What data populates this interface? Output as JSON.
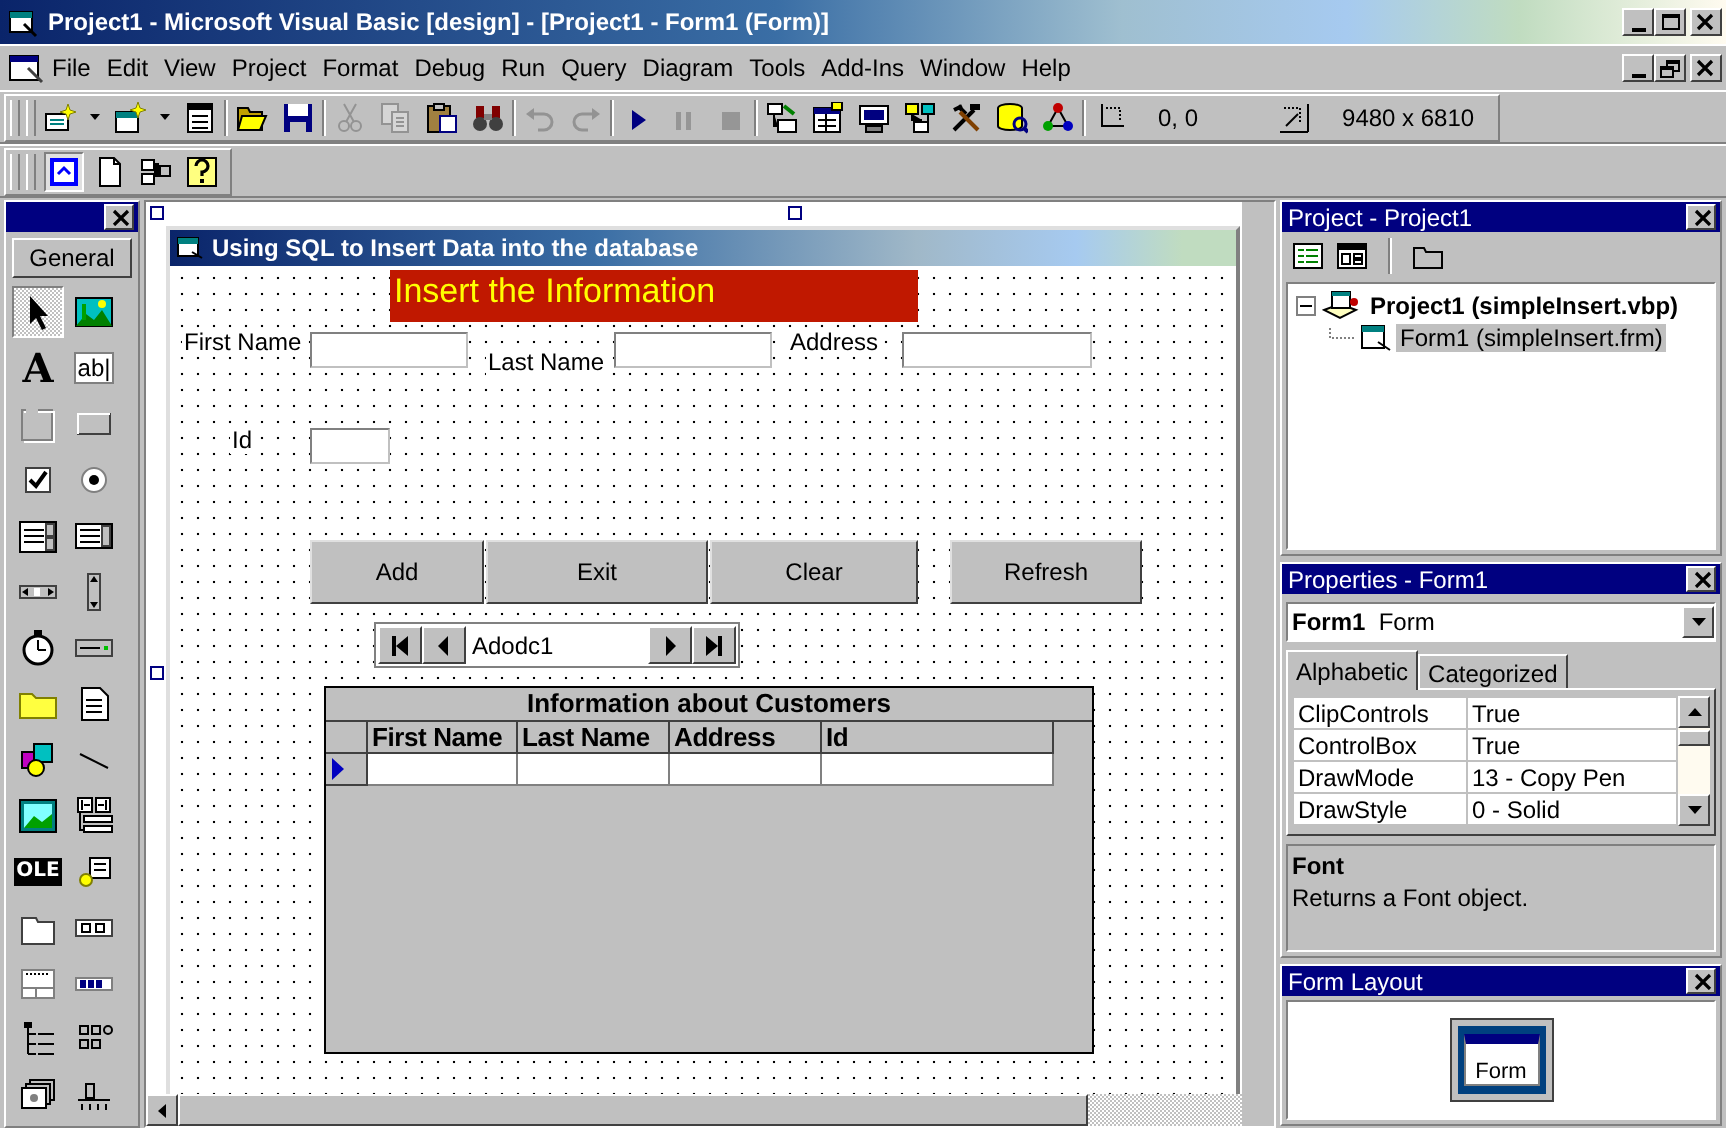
{
  "window": {
    "title": "Project1 - Microsoft Visual Basic [design] - [Project1 - Form1 (Form)]"
  },
  "menu": [
    {
      "label": "File"
    },
    {
      "label": "Edit"
    },
    {
      "label": "View"
    },
    {
      "label": "Project"
    },
    {
      "label": "Format"
    },
    {
      "label": "Debug"
    },
    {
      "label": "Run"
    },
    {
      "label": "Query"
    },
    {
      "label": "Diagram"
    },
    {
      "label": "Tools"
    },
    {
      "label": "Add-Ins"
    },
    {
      "label": "Window"
    },
    {
      "label": "Help"
    }
  ],
  "toolbar": {
    "groups": [
      [
        {
          "kind": "addproject",
          "disabled": false
        },
        {
          "kind": "addform",
          "disabled": false
        },
        {
          "kind": "menueditor",
          "disabled": false
        }
      ],
      [
        {
          "kind": "open",
          "disabled": false
        },
        {
          "kind": "save",
          "disabled": false
        }
      ],
      [
        {
          "kind": "cut",
          "disabled": true
        },
        {
          "kind": "copy",
          "disabled": true
        },
        {
          "kind": "paste",
          "disabled": false
        },
        {
          "kind": "find",
          "disabled": false
        }
      ],
      [
        {
          "kind": "undo",
          "disabled": true
        },
        {
          "kind": "redo",
          "disabled": true
        }
      ],
      [
        {
          "kind": "start",
          "disabled": false
        },
        {
          "kind": "pause",
          "disabled": true
        },
        {
          "kind": "stop",
          "disabled": true
        }
      ],
      [
        {
          "kind": "explorer",
          "disabled": false
        },
        {
          "kind": "properties",
          "disabled": false
        },
        {
          "kind": "layout",
          "disabled": false
        },
        {
          "kind": "browser",
          "disabled": false
        },
        {
          "kind": "toolbox",
          "disabled": false
        },
        {
          "kind": "dataview",
          "disabled": false
        },
        {
          "kind": "component",
          "disabled": false
        }
      ]
    ],
    "position": "0, 0",
    "size": "9480 x 6810"
  },
  "form_toolbar": [
    {
      "kind": "editform",
      "selected": true
    },
    {
      "kind": "page",
      "selected": false
    },
    {
      "kind": "hierarchy",
      "selected": false
    },
    {
      "kind": "help",
      "selected": false
    }
  ],
  "toolbox": {
    "tab": "General",
    "tools": [
      {
        "kind": "pointer",
        "selected": true
      },
      {
        "kind": "picture",
        "selected": false
      },
      {
        "kind": "label",
        "selected": false,
        "glyph": "A"
      },
      {
        "kind": "textbox",
        "selected": false,
        "glyph": "ab|"
      },
      {
        "kind": "frame",
        "selected": false
      },
      {
        "kind": "command",
        "selected": false
      },
      {
        "kind": "checkbox",
        "selected": false
      },
      {
        "kind": "option",
        "selected": false
      },
      {
        "kind": "combo",
        "selected": false
      },
      {
        "kind": "list",
        "selected": false
      },
      {
        "kind": "hscroll",
        "selected": false
      },
      {
        "kind": "vscroll",
        "selected": false
      },
      {
        "kind": "timer",
        "selected": false
      },
      {
        "kind": "drive",
        "selected": false
      },
      {
        "kind": "dir",
        "selected": false
      },
      {
        "kind": "file",
        "selected": false
      },
      {
        "kind": "shape",
        "selected": false
      },
      {
        "kind": "line",
        "selected": false
      },
      {
        "kind": "image",
        "selected": false
      },
      {
        "kind": "data",
        "selected": false
      },
      {
        "kind": "ole",
        "selected": false,
        "glyph": "OLE"
      },
      {
        "kind": "datalist",
        "selected": false
      },
      {
        "kind": "tabstrip",
        "selected": false
      },
      {
        "kind": "toolbarctl",
        "selected": false
      },
      {
        "kind": "statusbar",
        "selected": false
      },
      {
        "kind": "progress",
        "selected": false
      },
      {
        "kind": "tree",
        "selected": false
      },
      {
        "kind": "listview",
        "selected": false
      },
      {
        "kind": "imagelist",
        "selected": false
      },
      {
        "kind": "slider",
        "selected": false
      }
    ]
  },
  "form": {
    "title": "Using SQL to Insert Data into the database",
    "heading": "Insert the Information",
    "fields": [
      {
        "label": "First Name"
      },
      {
        "label": "Last Name"
      },
      {
        "label": "Address"
      },
      {
        "label": "Id"
      }
    ],
    "buttons": [
      "Add",
      "Exit",
      "Clear",
      "Refresh"
    ],
    "data_control": {
      "caption": "Adodc1"
    },
    "grid": {
      "caption": "Information about Customers",
      "columns": [
        "First Name",
        "Last Name",
        "Address",
        "Id"
      ],
      "rows": [
        {
          "current": true
        }
      ]
    }
  },
  "project": {
    "title": "Project - Project1",
    "tree": [
      {
        "label": "Project1 (simpleInsert.vbp)",
        "expanded": true,
        "selected": false,
        "children": [
          {
            "label": "Form1 (simpleInsert.frm)",
            "selected": true
          }
        ]
      }
    ]
  },
  "properties": {
    "title": "Properties - Form1",
    "object": "**Form1**  Form",
    "tabs": [
      {
        "label": "Alphabetic",
        "selected": true
      },
      {
        "label": "Categorized",
        "selected": false
      }
    ],
    "rows": [
      {
        "name": "ClipControls",
        "value": "True"
      },
      {
        "name": "ControlBox",
        "value": "True"
      },
      {
        "name": "DrawMode",
        "value": "13 - Copy Pen"
      },
      {
        "name": "DrawStyle",
        "value": "0 - Solid"
      }
    ],
    "description": {
      "name": "Font",
      "text": "Returns a Font object."
    }
  },
  "form_layout": {
    "title": "Form Layout",
    "thumbnail": "Form"
  }
}
